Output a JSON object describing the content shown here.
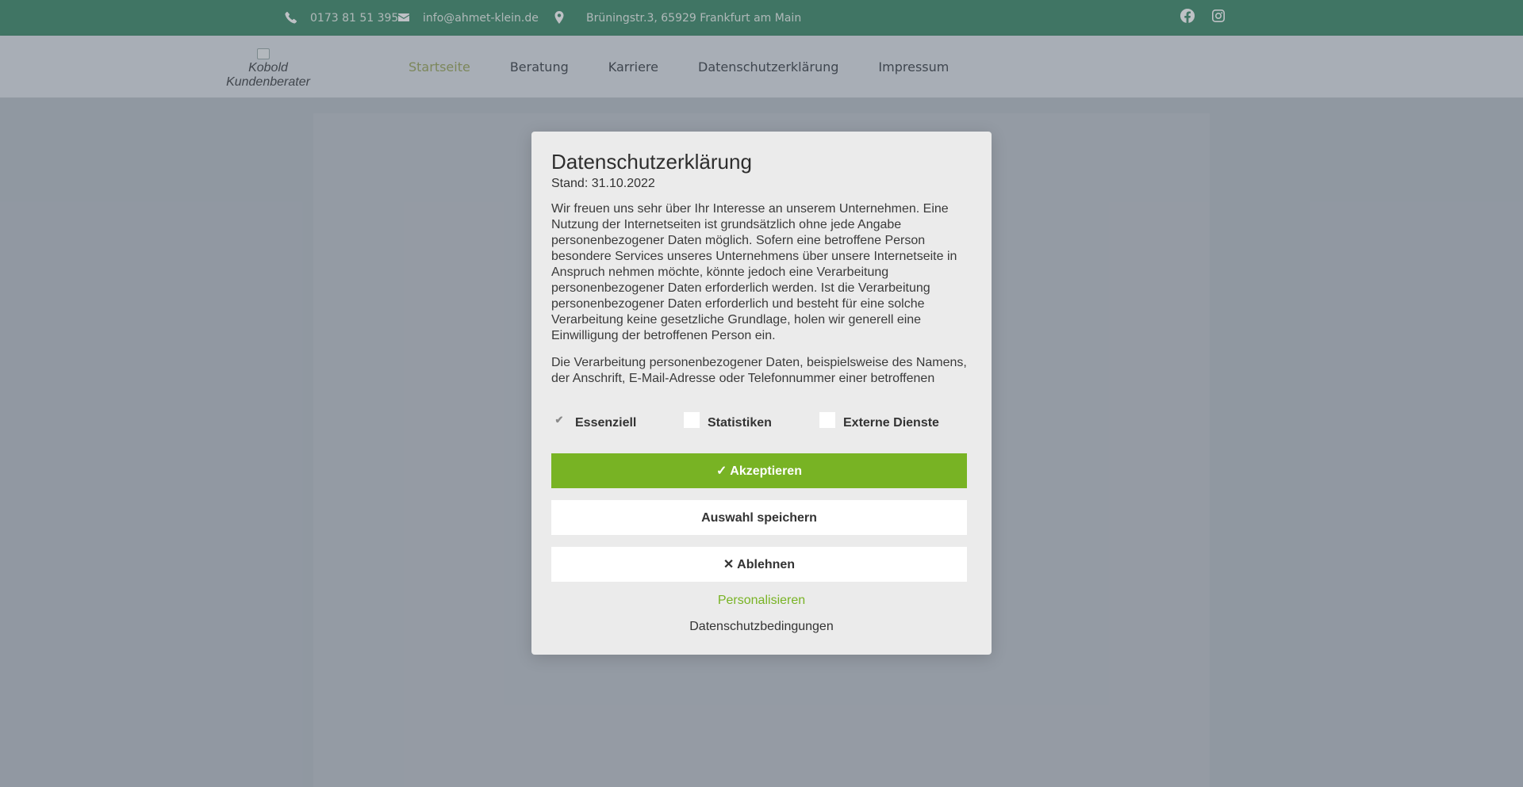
{
  "topbar": {
    "phone": "0173 81 51 395",
    "email": "info@ahmet-klein.de",
    "address": "Brüningstr.3, 65929 Frankfurt am Main",
    "icons": [
      "phone-icon",
      "envelope-icon",
      "map-marker-icon",
      "facebook-icon",
      "instagram-icon"
    ],
    "background_color": "#3e8a6a"
  },
  "header": {
    "logo_alt": "Kobold Kundenberater",
    "nav": [
      {
        "label": "Startseite",
        "active": true
      },
      {
        "label": "Beratung"
      },
      {
        "label": "Karriere"
      },
      {
        "label": "Datenschutzerklärung"
      },
      {
        "label": "Impressum"
      }
    ]
  },
  "modal": {
    "title": "Datenschutzerklärung",
    "stand": "Stand: 31.10.2022",
    "paragraphs": [
      "Wir freuen uns sehr über Ihr Interesse an unserem Unternehmen. Eine Nutzung der Internetseiten ist grundsätzlich ohne jede Angabe personenbezogener Daten möglich. Sofern eine betroffene Person besondere Services unseres Unternehmens über unsere Internetseite in Anspruch nehmen möchte, könnte jedoch eine Verarbeitung personenbezogener Daten erforderlich werden. Ist die Verarbeitung personenbezogener Daten erforderlich und besteht für eine solche Verarbeitung keine gesetzliche Grundlage, holen wir generell eine Einwilligung der betroffenen Person ein.",
      "Die Verarbeitung personenbezogener Daten, beispielsweise des Namens, der Anschrift, E-Mail-Adresse oder Telefonnummer einer betroffenen"
    ],
    "checkboxes": [
      {
        "label": "Essenziell",
        "checked": true,
        "disabled": true
      },
      {
        "label": "Statistiken",
        "checked": false
      },
      {
        "label": "Externe Dienste",
        "checked": false
      }
    ],
    "accept_label": "✓ Akzeptieren",
    "save_label": "Auswahl speichern",
    "deny_label": "✕ Ablehnen",
    "personalize_label": "Personalisieren",
    "terms_label": "Datenschutzbedingungen",
    "accent_color": "#78b324"
  }
}
